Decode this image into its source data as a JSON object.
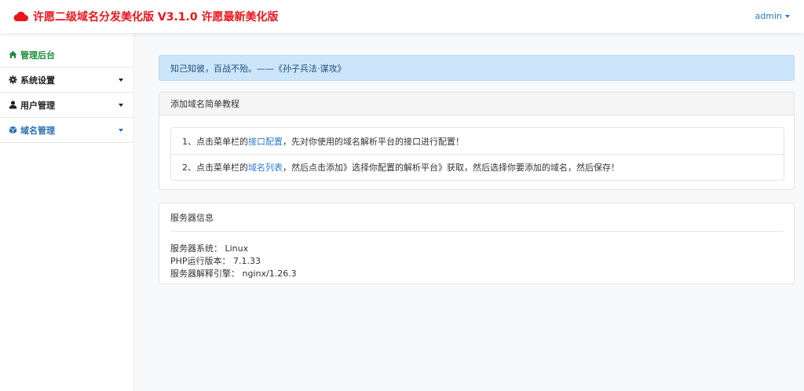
{
  "header": {
    "title": "许愿二级域名分发美化版 V3.1.0 许愿最新美化版",
    "user": "admin",
    "brand_color": "#e8151b",
    "logo_icon": "cloud-icon"
  },
  "sidebar": {
    "items": [
      {
        "label": "管理后台",
        "icon": "home-icon"
      },
      {
        "label": "系统设置",
        "icon": "gear-icon"
      },
      {
        "label": "用户管理",
        "icon": "user-icon"
      },
      {
        "label": "域名管理",
        "icon": "cube-icon"
      }
    ]
  },
  "main": {
    "quote": "知己知彼，百战不殆。——《孙子兵法·谋攻》",
    "tutorial": {
      "title": "添加域名简单教程",
      "step1": {
        "prefix": "1、点击菜单栏的",
        "link": "接口配置",
        "suffix": "，先对你使用的域名解析平台的接口进行配置！"
      },
      "step2": {
        "prefix": "2、点击菜单栏的",
        "link": "域名列表",
        "suffix": "，然后点击添加》选择你配置的解析平台》获取，然后选择你要添加的域名，然后保存！"
      }
    },
    "server": {
      "title": "服务器信息",
      "rows": [
        {
          "label": "服务器系统：",
          "value": "Linux"
        },
        {
          "label": "PHP运行版本：",
          "value": "7.1.33"
        },
        {
          "label": "服务器解释引擎：",
          "value": "nginx/1.26.3"
        }
      ]
    }
  }
}
